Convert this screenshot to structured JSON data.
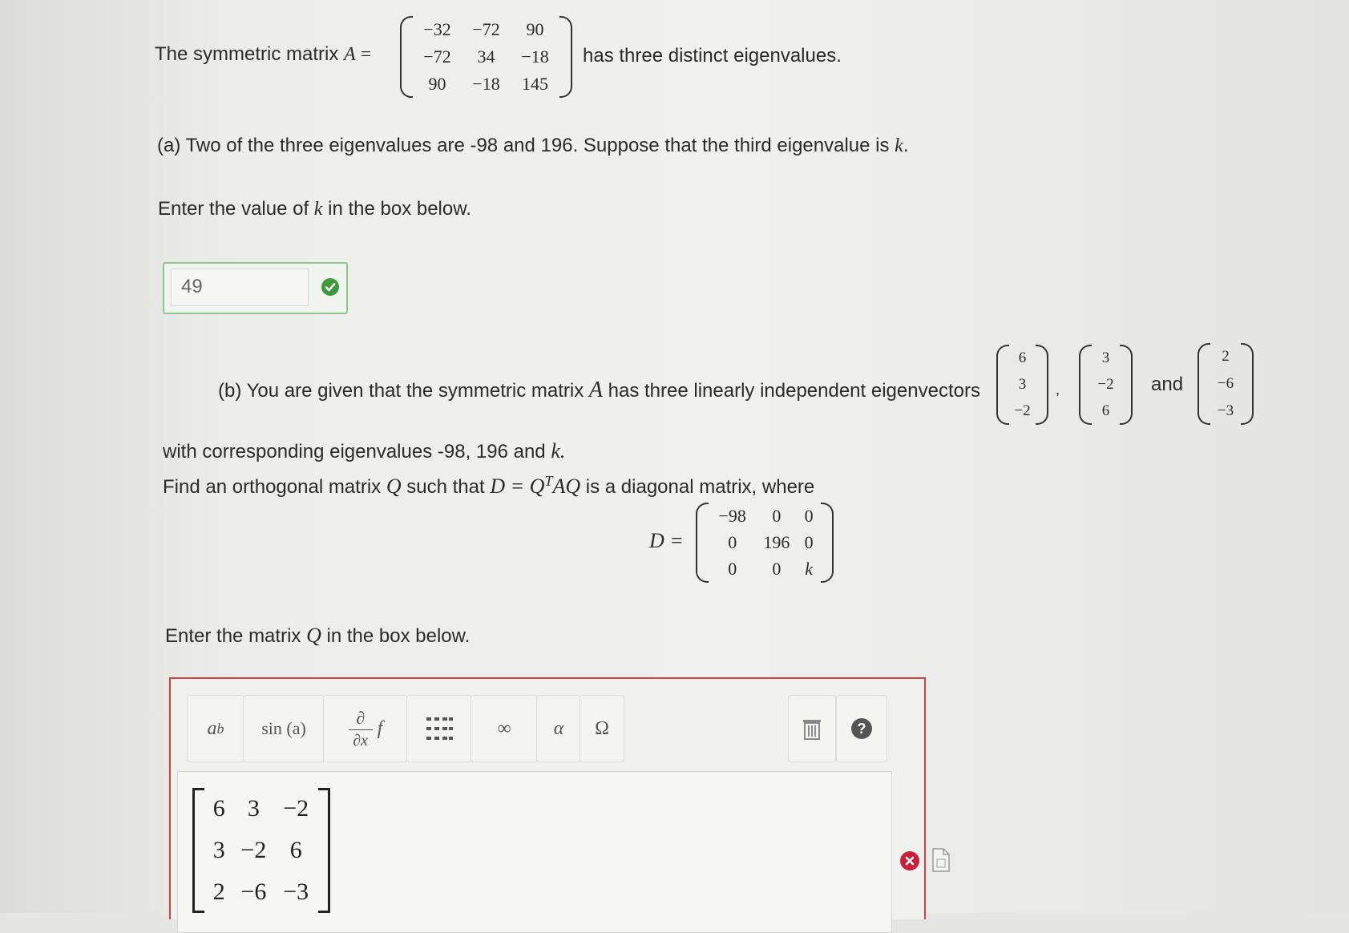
{
  "problem": {
    "intro_prefix": "The symmetric matrix ",
    "matrix_A_name": "A",
    "equals": " = ",
    "intro_suffix": "has three distinct eigenvalues.",
    "matrix_A": [
      [
        "−32",
        "−72",
        "90"
      ],
      [
        "−72",
        "34",
        "−18"
      ],
      [
        "90",
        "−18",
        "145"
      ]
    ]
  },
  "part_a": {
    "text_prefix": "(a) Two of the three eigenvalues are -98 and 196. Suppose that the third eigenvalue is ",
    "k": "k",
    "text_suffix": ".",
    "prompt_prefix": "Enter the value of ",
    "prompt_suffix": " in the box below.",
    "answer_value": "49",
    "status": "correct"
  },
  "part_b": {
    "line1_prefix": "(b) You are given that the symmetric matrix ",
    "matrix_name": "A",
    "line1_suffix": " has three linearly independent eigenvectors",
    "vectors": [
      [
        "6",
        "3",
        "−2"
      ],
      [
        "3",
        "−2",
        "6"
      ],
      [
        "2",
        "−6",
        "−3"
      ]
    ],
    "comma": ",",
    "and": "and",
    "line2": "with corresponding eigenvalues -98, 196 and ",
    "line2_k": "k.",
    "line3_prefix": "Find an orthogonal matrix ",
    "line3_Q": "Q",
    "line3_mid": " such that ",
    "line3_eq": "D = Q",
    "line3_T": "T",
    "line3_AQ": "AQ",
    "line3_suffix": " is a diagonal matrix, where",
    "D_label": "D =",
    "matrix_D": [
      [
        "−98",
        "0",
        "0"
      ],
      [
        "0",
        "196",
        "0"
      ],
      [
        "0",
        "0",
        "k"
      ]
    ],
    "prompt_prefix": "Enter the matrix ",
    "prompt_Q": "Q",
    "prompt_suffix": " in the box below."
  },
  "editor": {
    "toolbar": {
      "power_label": "a",
      "power_sup": "b",
      "sin_label": "sin (a)",
      "deriv_top": "∂",
      "deriv_bottom": "∂x",
      "deriv_f": "f",
      "infinity_label": "∞",
      "alpha_label": "α",
      "omega_label": "Ω",
      "help_label": "?"
    },
    "answer_matrix": [
      [
        "6",
        "3",
        "−2"
      ],
      [
        "3",
        "−2",
        "6"
      ],
      [
        "2",
        "−6",
        "−3"
      ]
    ],
    "status": "incorrect"
  },
  "colors": {
    "correct_green": "#3c9a3c",
    "incorrect_red": "#c8203a",
    "editor_border": "#cc4444"
  }
}
